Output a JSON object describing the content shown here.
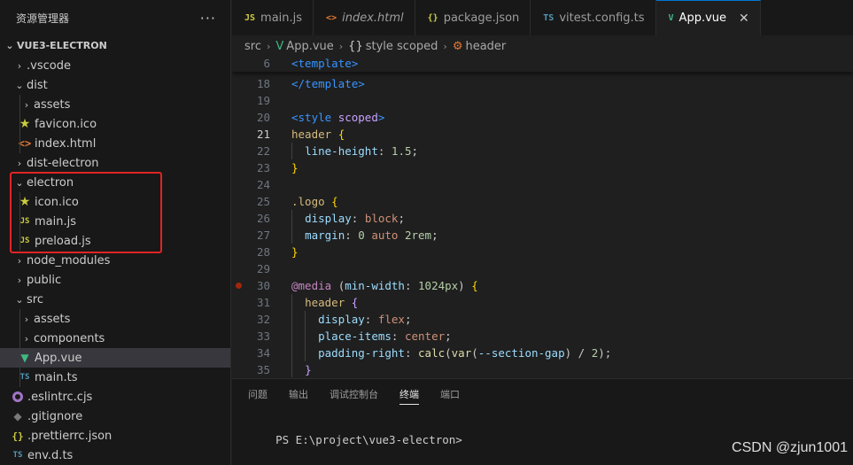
{
  "sidebar": {
    "title": "资源管理器",
    "more": "···",
    "section": "VUE3-ELECTRON",
    "items": [
      {
        "label": ".vscode",
        "icon": "chevron-right",
        "kind": "folder-collapsed",
        "depth": 1
      },
      {
        "label": "dist",
        "icon": "chevron-down",
        "kind": "folder-expanded",
        "depth": 1
      },
      {
        "label": "assets",
        "icon": "chevron-right",
        "kind": "folder-collapsed",
        "depth": 2
      },
      {
        "label": "favicon.ico",
        "icon": "star",
        "kind": "file",
        "depth": 2
      },
      {
        "label": "index.html",
        "icon": "html",
        "kind": "file",
        "depth": 2
      },
      {
        "label": "dist-electron",
        "icon": "chevron-right",
        "kind": "folder-collapsed",
        "depth": 1
      },
      {
        "label": "electron",
        "icon": "chevron-down",
        "kind": "folder-expanded",
        "depth": 1
      },
      {
        "label": "icon.ico",
        "icon": "star",
        "kind": "file",
        "depth": 2
      },
      {
        "label": "main.js",
        "icon": "js",
        "kind": "file",
        "depth": 2
      },
      {
        "label": "preload.js",
        "icon": "js",
        "kind": "file",
        "depth": 2
      },
      {
        "label": "node_modules",
        "icon": "chevron-right",
        "kind": "folder-collapsed",
        "depth": 1
      },
      {
        "label": "public",
        "icon": "chevron-right",
        "kind": "folder-collapsed",
        "depth": 1
      },
      {
        "label": "src",
        "icon": "chevron-down",
        "kind": "folder-expanded",
        "depth": 1
      },
      {
        "label": "assets",
        "icon": "chevron-right",
        "kind": "folder-collapsed",
        "depth": 2
      },
      {
        "label": "components",
        "icon": "chevron-right",
        "kind": "folder-collapsed",
        "depth": 2
      },
      {
        "label": "App.vue",
        "icon": "vue",
        "kind": "file",
        "depth": 2,
        "selected": true
      },
      {
        "label": "main.ts",
        "icon": "ts",
        "kind": "file",
        "depth": 2
      },
      {
        "label": ".eslintrc.cjs",
        "icon": "eslint",
        "kind": "file",
        "depth": 1
      },
      {
        "label": ".gitignore",
        "icon": "git",
        "kind": "file",
        "depth": 1
      },
      {
        "label": ".prettierrc.json",
        "icon": "json",
        "kind": "file",
        "depth": 1
      },
      {
        "label": "env.d.ts",
        "icon": "ts",
        "kind": "file",
        "depth": 1
      }
    ]
  },
  "tabs": [
    {
      "label": "main.js",
      "icon_text": "JS",
      "icon_color": "#cbcb41",
      "italic": false,
      "active": false
    },
    {
      "label": "index.html",
      "icon_text": "<>",
      "icon_color": "#e37933",
      "italic": true,
      "active": false
    },
    {
      "label": "package.json",
      "icon_text": "{}",
      "icon_color": "#cbcb41",
      "italic": false,
      "active": false
    },
    {
      "label": "vitest.config.ts",
      "icon_text": "TS",
      "icon_color": "#519aba",
      "italic": false,
      "active": false
    },
    {
      "label": "App.vue",
      "icon_text": "V",
      "icon_color": "#41b883",
      "italic": false,
      "active": true,
      "close": "✕"
    }
  ],
  "breadcrumb": {
    "parts": [
      "src",
      "App.vue",
      "style scoped",
      "header"
    ],
    "icons": [
      "",
      "V",
      "{}",
      "⚙"
    ]
  },
  "editor": {
    "sticky_line": {
      "num": "6",
      "code": [
        [
          "t-tag",
          "<template>"
        ]
      ]
    },
    "active_line": "21",
    "breakpoint_line": "30",
    "lines": [
      {
        "num": "18",
        "indent": 0,
        "code": [
          [
            "t-tag",
            "</template>"
          ]
        ]
      },
      {
        "num": "19",
        "indent": 0,
        "code": []
      },
      {
        "num": "20",
        "indent": 0,
        "code": [
          [
            "t-tag",
            "<style "
          ],
          [
            "t-attr2",
            "scoped"
          ],
          [
            "t-tag",
            ">"
          ]
        ]
      },
      {
        "num": "21",
        "indent": 0,
        "code": [
          [
            "t-sel",
            "header "
          ],
          [
            "t-brace",
            "{"
          ]
        ]
      },
      {
        "num": "22",
        "indent": 1,
        "code": [
          [
            "t-prop",
            "line-height"
          ],
          [
            "t-p",
            ": "
          ],
          [
            "t-num",
            "1.5"
          ],
          [
            "t-p",
            ";"
          ]
        ]
      },
      {
        "num": "23",
        "indent": 0,
        "code": [
          [
            "t-brace",
            "}"
          ]
        ]
      },
      {
        "num": "24",
        "indent": 0,
        "code": []
      },
      {
        "num": "25",
        "indent": 0,
        "code": [
          [
            "t-sel",
            ".logo "
          ],
          [
            "t-brace",
            "{"
          ]
        ]
      },
      {
        "num": "26",
        "indent": 1,
        "code": [
          [
            "t-prop",
            "display"
          ],
          [
            "t-p",
            ": "
          ],
          [
            "t-val",
            "block"
          ],
          [
            "t-p",
            ";"
          ]
        ]
      },
      {
        "num": "27",
        "indent": 1,
        "code": [
          [
            "t-prop",
            "margin"
          ],
          [
            "t-p",
            ": "
          ],
          [
            "t-num",
            "0 "
          ],
          [
            "t-val",
            "auto "
          ],
          [
            "t-num",
            "2rem"
          ],
          [
            "t-p",
            ";"
          ]
        ]
      },
      {
        "num": "28",
        "indent": 0,
        "code": [
          [
            "t-brace",
            "}"
          ]
        ]
      },
      {
        "num": "29",
        "indent": 0,
        "code": []
      },
      {
        "num": "30",
        "indent": 0,
        "code": [
          [
            "t-at",
            "@media "
          ],
          [
            "t-p",
            "("
          ],
          [
            "t-prop",
            "min-width"
          ],
          [
            "t-p",
            ": "
          ],
          [
            "t-num",
            "1024px"
          ],
          [
            "t-p",
            ") "
          ],
          [
            "t-brace",
            "{"
          ]
        ]
      },
      {
        "num": "31",
        "indent": 1,
        "code": [
          [
            "t-sel",
            "header "
          ],
          [
            "t-attr2",
            "{"
          ]
        ]
      },
      {
        "num": "32",
        "indent": 2,
        "code": [
          [
            "t-prop",
            "display"
          ],
          [
            "t-p",
            ": "
          ],
          [
            "t-val",
            "flex"
          ],
          [
            "t-p",
            ";"
          ]
        ]
      },
      {
        "num": "33",
        "indent": 2,
        "code": [
          [
            "t-prop",
            "place-items"
          ],
          [
            "t-p",
            ": "
          ],
          [
            "t-val",
            "center"
          ],
          [
            "t-p",
            ";"
          ]
        ]
      },
      {
        "num": "34",
        "indent": 2,
        "code": [
          [
            "t-prop",
            "padding-right"
          ],
          [
            "t-p",
            ": "
          ],
          [
            "t-fn",
            "calc"
          ],
          [
            "t-p",
            "("
          ],
          [
            "t-fn",
            "var"
          ],
          [
            "t-p",
            "("
          ],
          [
            "t-prop",
            "--section-gap"
          ],
          [
            "t-p",
            ") / "
          ],
          [
            "t-num",
            "2"
          ],
          [
            "t-p",
            ");"
          ]
        ]
      },
      {
        "num": "35",
        "indent": 1,
        "code": [
          [
            "t-attr2",
            "}"
          ]
        ]
      }
    ]
  },
  "panel": {
    "tabs": [
      "问题",
      "输出",
      "调试控制台",
      "终端",
      "端口"
    ],
    "active_tab": "终端",
    "terminal_prompt": "PS E:\\project\\vue3-electron>"
  },
  "watermark": "CSDN @zjun1001"
}
